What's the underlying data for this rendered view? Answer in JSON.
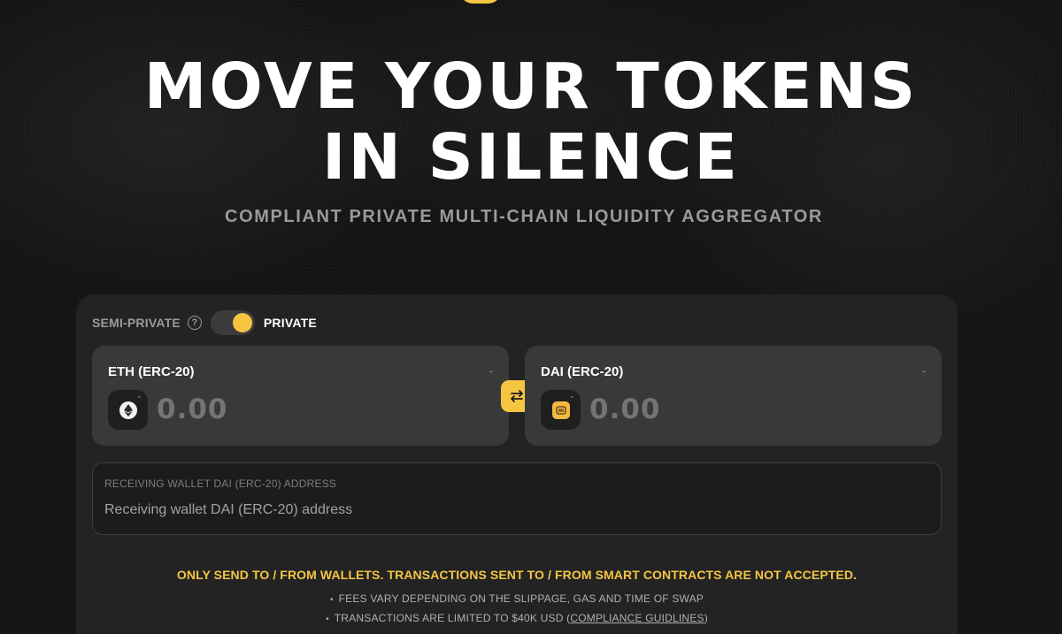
{
  "hero": {
    "title_line1": "MOVE YOUR TOKENS",
    "title_line2": "IN SILENCE",
    "subtitle": "COMPLIANT PRIVATE MULTI-CHAIN LIQUIDITY AGGREGATOR"
  },
  "mode": {
    "left_label": "SEMI-PRIVATE",
    "help_glyph": "?",
    "right_label": "PRIVATE",
    "selected": "PRIVATE",
    "accent_color": "#f5c542"
  },
  "from_token": {
    "name": "ETH (ERC-20)",
    "balance": "-",
    "icon": "eth-icon",
    "amount_placeholder": "0.00"
  },
  "to_token": {
    "name": "DAI (ERC-20)",
    "balance": "-",
    "icon": "dai-icon",
    "amount_placeholder": "0.00"
  },
  "swap": {
    "icon": "swap-arrows-icon"
  },
  "address": {
    "label": "RECEIVING WALLET DAI (ERC-20) ADDRESS",
    "placeholder": "Receiving wallet DAI (ERC-20) address"
  },
  "notices": {
    "warning": "ONLY SEND TO / FROM WALLETS. TRANSACTIONS SENT TO / FROM SMART CONTRACTS ARE NOT ACCEPTED.",
    "bullet1": "FEES VARY DEPENDING ON THE SLIPPAGE, GAS AND TIME OF SWAP",
    "bullet2_prefix": "TRANSACTIONS ARE LIMITED TO $40K USD (",
    "bullet2_link": "COMPLIANCE GUIDLINES",
    "bullet2_suffix": ")"
  }
}
